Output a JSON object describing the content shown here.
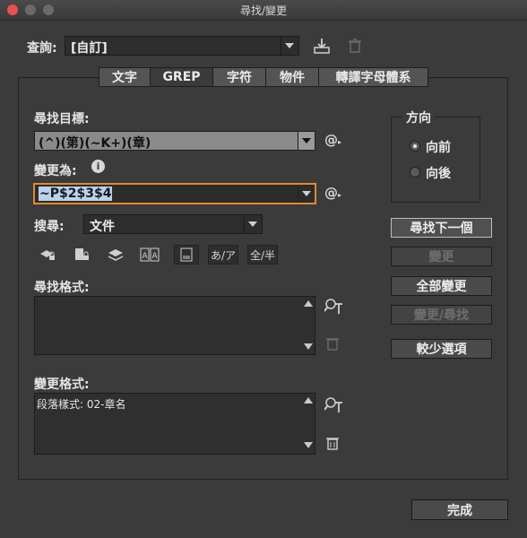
{
  "window": {
    "title": "尋找/變更"
  },
  "query": {
    "label": "查詢:",
    "value": "[自訂]"
  },
  "tabs": [
    {
      "label": "文字",
      "active": false
    },
    {
      "label": "GREP",
      "active": true
    },
    {
      "label": "字符",
      "active": false
    },
    {
      "label": "物件",
      "active": false
    },
    {
      "label": "轉譯字母體系",
      "active": false
    }
  ],
  "find_what": {
    "label": "尋找目標:",
    "value": "(^)(第)(~K+)(章)"
  },
  "change_to": {
    "label": "變更為:",
    "value": "~P$2$3$4"
  },
  "search": {
    "label": "搜尋:",
    "value": "文件"
  },
  "direction": {
    "title": "方向",
    "forward": "向前",
    "backward": "向後",
    "selected": "forward"
  },
  "buttons": {
    "find_next": "尋找下一個",
    "change": "變更",
    "change_all": "全部變更",
    "change_find": "變更/尋找",
    "fewer_options": "較少選項",
    "done": "完成"
  },
  "option_icons": {
    "kana": "あ/ア",
    "width": "全/半"
  },
  "find_format": {
    "label": "尋找格式:",
    "value": ""
  },
  "change_format": {
    "label": "變更格式:",
    "value": "段落樣式: 02-章名"
  },
  "colors": {
    "focus_ring": "#e08a2c",
    "selection": "#b9d2ef"
  }
}
